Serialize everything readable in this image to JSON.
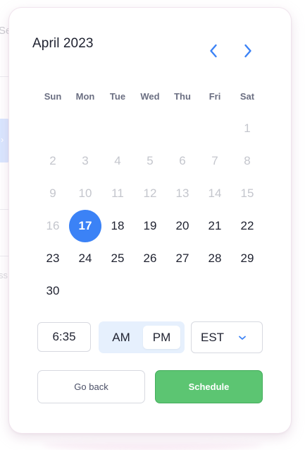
{
  "background": {
    "top_text": "Se",
    "chip_glyph": "›",
    "mid_text": "ss"
  },
  "calendar": {
    "title": "April 2023",
    "prev_label": "Previous month",
    "next_label": "Next month",
    "weekdays": [
      "Sun",
      "Mon",
      "Tue",
      "Wed",
      "Thu",
      "Fri",
      "Sat"
    ],
    "days": {
      "d1": "1",
      "d2": "2",
      "d3": "3",
      "d4": "4",
      "d5": "5",
      "d6": "6",
      "d7": "7",
      "d8": "8",
      "d9": "9",
      "d10": "10",
      "d11": "11",
      "d12": "12",
      "d13": "13",
      "d14": "14",
      "d15": "15",
      "d16": "16",
      "d17": "17",
      "d18": "18",
      "d19": "19",
      "d20": "20",
      "d21": "21",
      "d22": "22",
      "d23": "23",
      "d24": "24",
      "d25": "25",
      "d26": "26",
      "d27": "27",
      "d28": "28",
      "d29": "29",
      "d30": "30"
    },
    "selected_day": "17"
  },
  "time": {
    "value": "6:35",
    "am_label": "AM",
    "pm_label": "PM",
    "selected_period": "PM",
    "timezone": "EST"
  },
  "actions": {
    "back_label": "Go back",
    "schedule_label": "Schedule"
  },
  "colors": {
    "accent": "#3b82f6",
    "schedule_green": "#5cc572",
    "ampm_bg": "#e6f0fd",
    "disabled_text": "#c4c6cd"
  },
  "icons": {
    "prev": "chevron-left-icon",
    "next": "chevron-right-icon",
    "timezone": "chevron-down-icon"
  }
}
